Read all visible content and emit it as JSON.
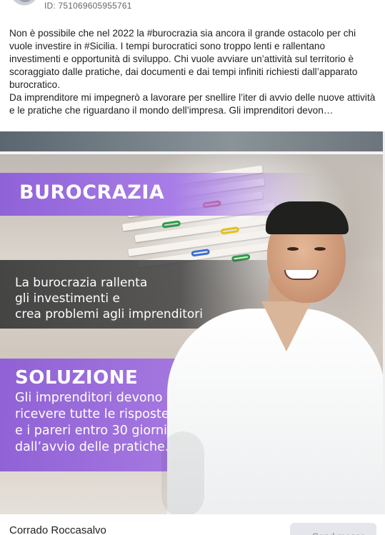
{
  "header": {
    "post_id": "ID: 751069605955761"
  },
  "post": {
    "paragraph_1": "Non è possibile che nel 2022 la #burocrazia sia ancora il grande ostacolo per chi vuole investire in #Sicilia. I tempi burocratici sono troppo lenti e rallentano investimenti e opportunità di sviluppo. Chi vuole avviare un’attività sul territorio è scoraggiato dalle pratiche, dai documenti e dai tempi infiniti richiesti dall’apparato burocratico.",
    "paragraph_2": "Da imprenditore mi impegnerò a lavorare per snellire l’iter di avvio delle nuove attività e le pratiche che riguardano il mondo dell’impresa. Gli imprenditori devon…"
  },
  "image": {
    "headline": "BUROCRAZIA",
    "problem_lines": [
      "La burocrazia rallenta",
      "gli investimenti e",
      "crea problemi agli imprenditori"
    ],
    "solution_title": "SOLUZIONE",
    "solution_lines": [
      "Gli imprenditori devono",
      "ricevere tutte le risposte",
      "e i pareri entro 30 giorni",
      "dall’avvio delle pratiche."
    ]
  },
  "footer": {
    "author": "Corrado Roccasalvo",
    "send_button": "Send messa"
  },
  "colors": {
    "purple": "#9a6ee0",
    "dark_band": "#3a3a3a",
    "button_bg": "#e4e6eb"
  }
}
